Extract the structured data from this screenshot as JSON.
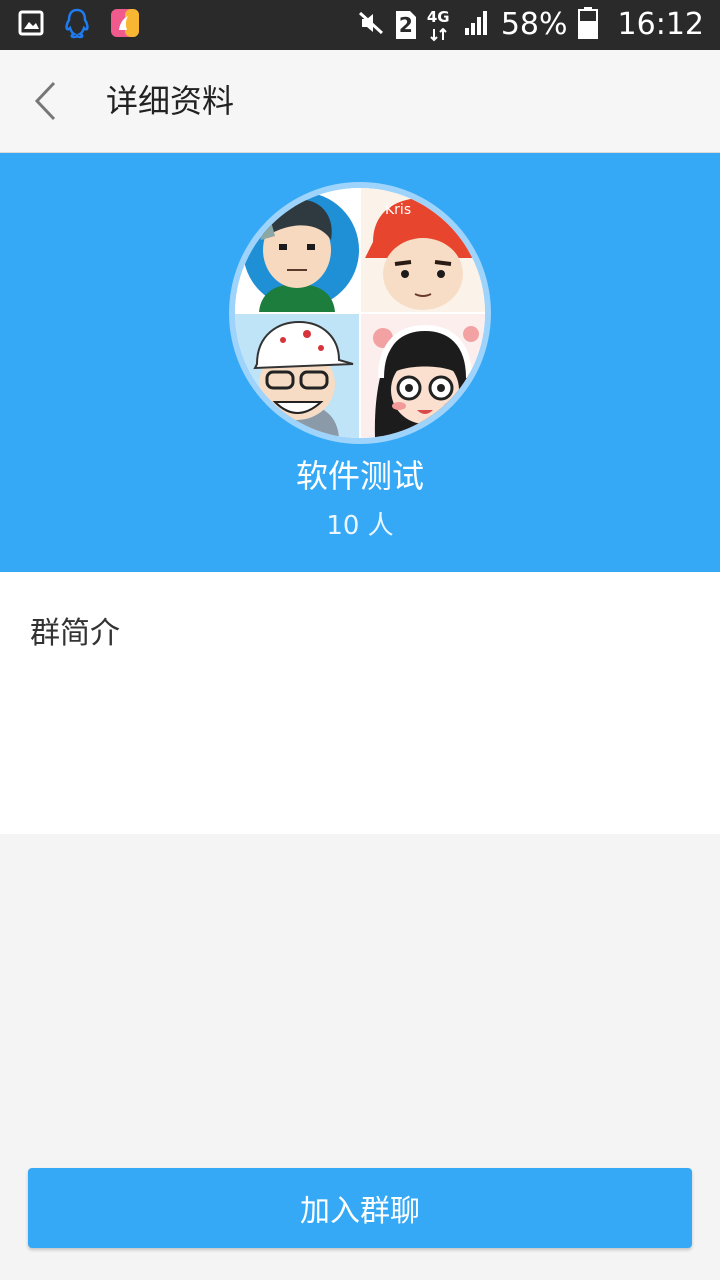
{
  "status_bar": {
    "sim_slot": "2",
    "network": "4G",
    "battery": "58%",
    "time": "16:12",
    "left_icons": [
      "gallery-icon",
      "qq-penguin-icon",
      "app-notification-icon"
    ],
    "right_icons": [
      "mute-icon",
      "sim-icon",
      "network-4g-icon",
      "signal-icon",
      "battery-icon"
    ]
  },
  "nav": {
    "back_icon": "chevron-left-icon",
    "title": "详细资料"
  },
  "group": {
    "name": "软件测试",
    "member_count": "10 人",
    "avatar": "group-avatar-collage"
  },
  "intro": {
    "label": "群简介",
    "text": ""
  },
  "actions": {
    "join_label": "加入群聊"
  },
  "colors": {
    "accent": "#36a9f6",
    "status_bar": "#2a2a2a",
    "nav_bar": "#f6f6f6",
    "page_background": "#f4f4f5"
  }
}
